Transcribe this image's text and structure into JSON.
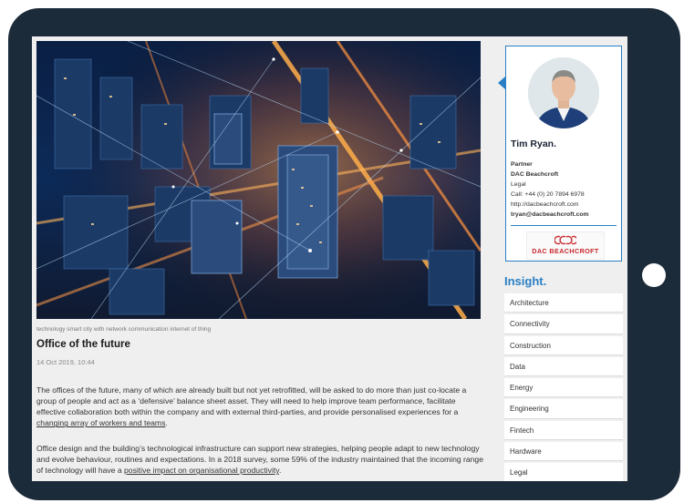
{
  "article": {
    "image_caption": "technology smart city with network communication internet of thing",
    "title": "Office of the future",
    "date": "14 Oct 2019, 10:44",
    "p1_text": "The offices of the future, many of which are already built but not yet retrofitted, will be asked to do more than just co-locate a group of people and act as a ‘defensive’ balance sheet asset. They will need to help improve team performance, facilitate effective collaboration both within the company and with external third-parties, and provide personalised experiences for a ",
    "p1_link": "changing array of workers and teams",
    "p1_end": ".",
    "p2_text": "Office design and the building’s technological infrastructure can support new strategies, helping people adapt to new technology and evolve behaviour, routines and expectations. In a 2018 survey, some 59% of the industry maintained that the incoming range of technology will have a ",
    "p2_link": "positive impact on organisational productivity",
    "p2_end": "."
  },
  "profile": {
    "name": "Tim Ryan.",
    "role": "Partner",
    "company": "DAC Beachcroft",
    "department": "Legal",
    "phone": "Call: +44 (0) 20 7894 6978",
    "website": "http://dacbeachcroft.com",
    "email": "tryan@dacbeachcroft.com",
    "logo_text": "DAC BEACHCROFT"
  },
  "insight": {
    "heading": "Insight.",
    "topics": [
      "Architecture",
      "Connectivity",
      "Construction",
      "Data",
      "Energy",
      "Engineering",
      "Fintech",
      "Hardware",
      "Legal"
    ]
  },
  "colors": {
    "frame": "#1c2b3a",
    "accent": "#2a7fc4",
    "logo_red": "#c8262b"
  }
}
